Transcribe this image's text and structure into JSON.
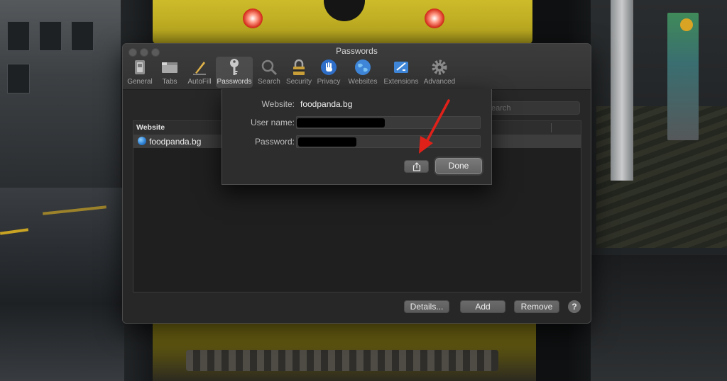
{
  "window": {
    "title": "Passwords"
  },
  "toolbar": {
    "items": [
      {
        "label": "General",
        "icon": "general-switch-icon"
      },
      {
        "label": "Tabs",
        "icon": "tabs-icon"
      },
      {
        "label": "AutoFill",
        "icon": "autofill-pencil-icon"
      },
      {
        "label": "Passwords",
        "icon": "key-icon"
      },
      {
        "label": "Search",
        "icon": "magnifier-icon"
      },
      {
        "label": "Security",
        "icon": "padlock-icon"
      },
      {
        "label": "Privacy",
        "icon": "hand-icon"
      },
      {
        "label": "Websites",
        "icon": "globe-icon"
      },
      {
        "label": "Extensions",
        "icon": "extensions-icon"
      },
      {
        "label": "Advanced",
        "icon": "gear-icon"
      }
    ],
    "active": "Passwords"
  },
  "search": {
    "text": "earch"
  },
  "table": {
    "columns": [
      "Website"
    ],
    "rows": [
      {
        "website": "foodpanda.bg"
      }
    ]
  },
  "buttons": {
    "details": "Details...",
    "add": "Add",
    "remove": "Remove",
    "help": "?"
  },
  "sheet": {
    "website_label": "Website:",
    "website_value": "foodpanda.bg",
    "username_label": "User name:",
    "password_label": "Password:",
    "done_label": "Done",
    "share_icon": "share-icon"
  },
  "colors": {
    "annotation_arrow": "#e0211a",
    "accent_globe": "#2f83d6"
  }
}
